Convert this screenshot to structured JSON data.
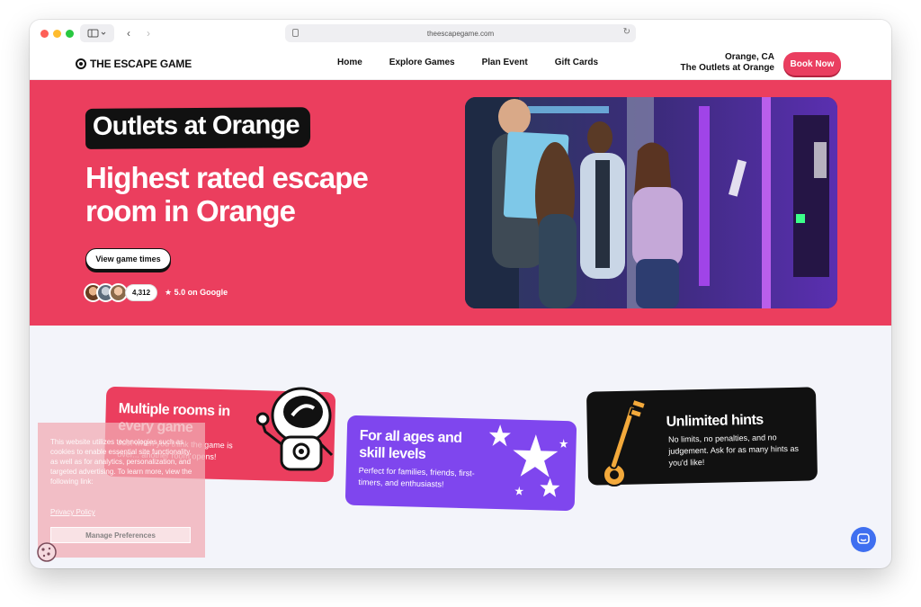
{
  "browser": {
    "url": "theescapegame.com"
  },
  "header": {
    "logo_text": "THE ESCAPE GAME",
    "nav": [
      {
        "label": "Home"
      },
      {
        "label": "Explore Games"
      },
      {
        "label": "Plan Event"
      },
      {
        "label": "Gift Cards"
      }
    ],
    "location_city": "Orange, CA",
    "location_venue": "The Outlets at Orange",
    "book_label": "Book Now"
  },
  "hero": {
    "tag": "Outlets at Orange",
    "title": "Highest rated escape room in Orange",
    "cta_label": "View game times",
    "review_count": "4,312",
    "rating_text": "★ 5.0 on Google"
  },
  "cards": [
    {
      "title": "Multiple rooms in every game",
      "text": "Just when you think the game is over... another room opens!"
    },
    {
      "title": "For all ages and skill levels",
      "text": "Perfect for families, friends, first-timers, and enthusiasts!"
    },
    {
      "title": "Unlimited hints",
      "text": "No limits, no penalties, and no judgement. Ask for as many hints as you'd like!"
    }
  ],
  "cookie": {
    "text": "This website utilizes technologies such as cookies to enable essential site functionality, as well as for analytics, personalization, and targeted advertising. To learn more, view the following link:",
    "link": "Privacy Policy",
    "button": "Manage Preferences"
  },
  "colors": {
    "brand_pink": "#eb3e5e",
    "brand_purple": "#7f46ee",
    "chat_blue": "#3f6ff0"
  }
}
